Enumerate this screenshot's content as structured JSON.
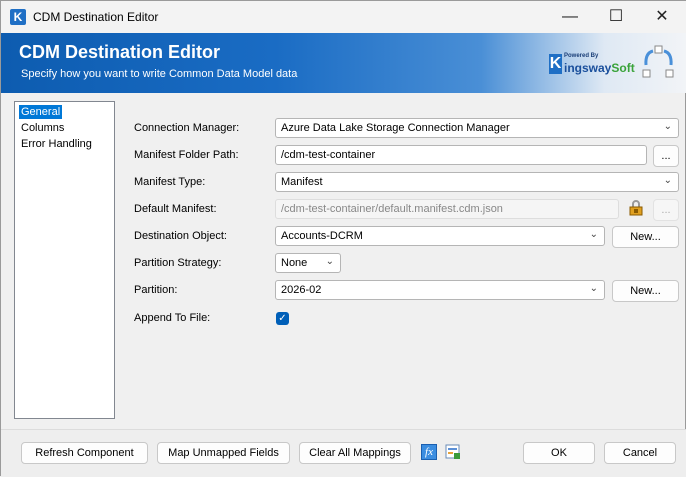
{
  "window": {
    "title": "CDM Destination Editor",
    "app_icon": "K"
  },
  "banner": {
    "title": "CDM Destination Editor",
    "subtitle": "Specify how you want to write Common Data Model data",
    "logo_powered": "Powered By",
    "logo_brand_k": "K",
    "logo_brand_a": "ingsway",
    "logo_brand_b": "Soft"
  },
  "nav": {
    "items": [
      {
        "label": "General",
        "selected": true
      },
      {
        "label": "Columns"
      },
      {
        "label": "Error Handling"
      }
    ]
  },
  "form": {
    "connection_manager": {
      "label": "Connection Manager:",
      "value": "Azure Data Lake Storage Connection Manager"
    },
    "manifest_folder_path": {
      "label": "Manifest Folder Path:",
      "value": "/cdm-test-container",
      "browse": "..."
    },
    "manifest_type": {
      "label": "Manifest Type:",
      "value": "Manifest"
    },
    "default_manifest": {
      "label": "Default Manifest:",
      "value": "/cdm-test-container/default.manifest.cdm.json",
      "browse": "..."
    },
    "destination_object": {
      "label": "Destination Object:",
      "value": "Accounts-DCRM",
      "new": "New..."
    },
    "partition_strategy": {
      "label": "Partition Strategy:",
      "value": "None"
    },
    "partition": {
      "label": "Partition:",
      "value": "2026-02",
      "new": "New..."
    },
    "append_to_file": {
      "label": "Append To File:",
      "checked": true
    }
  },
  "footer": {
    "refresh": "Refresh Component",
    "map_unmapped": "Map Unmapped Fields",
    "clear_all": "Clear All Mappings",
    "fx_icon": "fx",
    "ok": "OK",
    "cancel": "Cancel"
  },
  "colors": {
    "accent": "#0078d7",
    "banner": "#1a6cc4"
  }
}
